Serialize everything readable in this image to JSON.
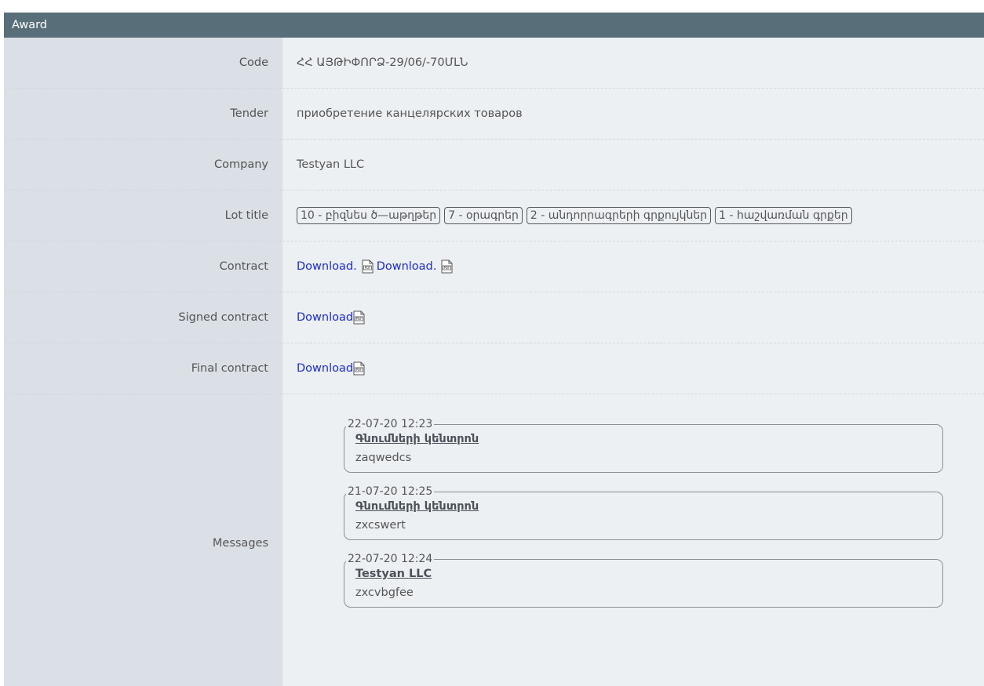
{
  "panel": {
    "title": "Award"
  },
  "fields": {
    "code": {
      "label": "Code",
      "value": "ՀՀ ԱՅԹԻՓՈՐՁ-29/06/-70ՄԼՆ"
    },
    "tender": {
      "label": "Tender",
      "value": "приобретение канцелярских товаров"
    },
    "company": {
      "label": "Company",
      "value": "Testyan LLC"
    },
    "lot_title": {
      "label": "Lot title",
      "lots": [
        "10 - բիզնես ծ—աթղթեր",
        "7 - օրագրեր",
        "2 - անդորրագրերի գրքույկներ",
        "1 - հաշվառման գրքեր"
      ]
    },
    "contract": {
      "label": "Contract",
      "links": [
        "Download.",
        "Download."
      ]
    },
    "signed_contract": {
      "label": "Signed contract",
      "link": "Download"
    },
    "final_contract": {
      "label": "Final contract",
      "link": "Download"
    },
    "messages": {
      "label": "Messages",
      "items": [
        {
          "date": "22-07-20 12:23",
          "author": "Գնումների կենտրոն",
          "text": "zaqwedcs"
        },
        {
          "date": "21-07-20 12:25",
          "author": "Գնումների կենտրոն",
          "text": "zxcswert"
        },
        {
          "date": "22-07-20 12:24",
          "author": "Testyan LLC",
          "text": "zxcvbgfee"
        }
      ]
    }
  },
  "icons": {
    "download": "pdf-file-icon"
  },
  "colors": {
    "header_bg": "#586e79",
    "label_bg": "#dbe0e6",
    "value_bg": "#edf0f3",
    "link": "#1a2ccf"
  }
}
